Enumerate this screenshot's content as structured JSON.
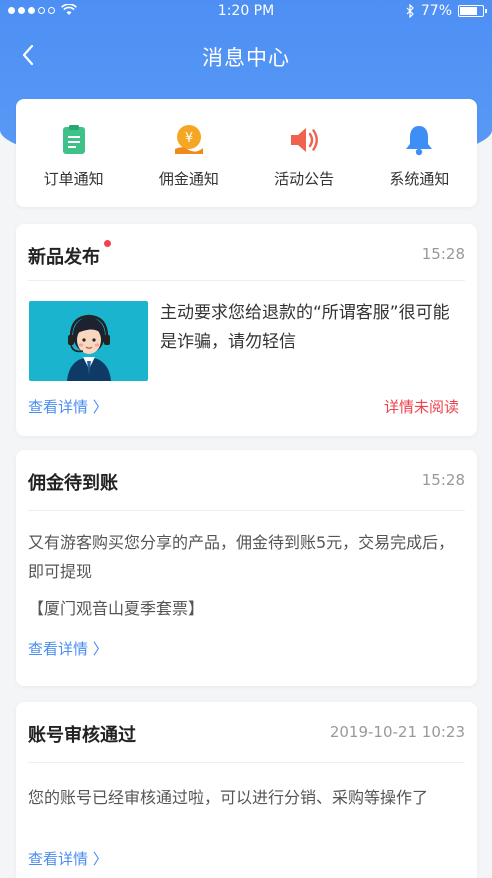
{
  "status": {
    "time": "1:20 PM",
    "battery": "77%",
    "battery_level": 0.77
  },
  "nav": {
    "title": "消息中心"
  },
  "categories": [
    {
      "label": "订单通知",
      "icon": "clipboard-icon",
      "color": "#3ec28a"
    },
    {
      "label": "佣金通知",
      "icon": "commission-coin-icon",
      "color": "#f5a623"
    },
    {
      "label": "活动公告",
      "icon": "speaker-icon",
      "color": "#f0614e"
    },
    {
      "label": "系统通知",
      "icon": "bell-icon",
      "color": "#3f8ef5"
    }
  ],
  "messages": [
    {
      "title": "新品发布",
      "time": "15:28",
      "unread_dot": true,
      "body": "主动要求您给退款的“所谓客服”很可能是诈骗，请勿轻信",
      "link": "查看详情 〉",
      "status": "详情未阅读"
    },
    {
      "title": "佣金待到账",
      "time": "15:28",
      "body": "又有游客购买您分享的产品，佣金待到账5元，交易完成后，即可提现",
      "product": "【厦门观音山夏季套票】",
      "link": "查看详情 〉"
    },
    {
      "title": "账号审核通过",
      "time": "2019-10-21 10:23",
      "body": "您的账号已经审核通过啦，可以进行分销、采购等操作了",
      "link": "查看详情 〉"
    }
  ],
  "colors": {
    "primary": "#4d8ff3",
    "link": "#4a8cf0",
    "alert": "#f0414e"
  }
}
